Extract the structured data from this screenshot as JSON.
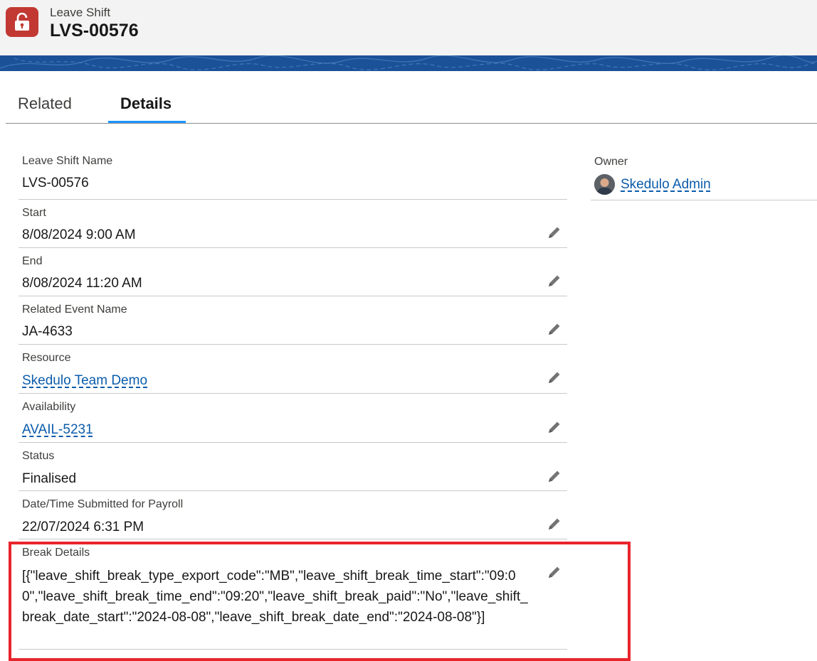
{
  "header": {
    "object_label": "Leave Shift",
    "record_title": "LVS-00576",
    "icon": "lock-icon",
    "icon_color": "#c23934",
    "banner_color": "#1b5297"
  },
  "tabs": [
    {
      "label": "Related",
      "active": false
    },
    {
      "label": "Details",
      "active": true
    }
  ],
  "fields": {
    "name": {
      "label": "Leave Shift Name",
      "value": "LVS-00576"
    },
    "start": {
      "label": "Start",
      "value": "8/08/2024 9:00 AM"
    },
    "end": {
      "label": "End",
      "value": "8/08/2024 11:20 AM"
    },
    "related_event": {
      "label": "Related Event Name",
      "value": "JA-4633"
    },
    "resource": {
      "label": "Resource",
      "value": "Skedulo Team Demo"
    },
    "availability": {
      "label": "Availability",
      "value": "AVAIL-5231"
    },
    "status": {
      "label": "Status",
      "value": "Finalised"
    },
    "submitted": {
      "label": "Date/Time Submitted for Payroll",
      "value": "22/07/2024 6:31 PM"
    },
    "break_details": {
      "label": "Break Details",
      "value": "[{\"leave_shift_break_type_export_code\":\"MB\",\"leave_shift_break_time_start\":\"09:00\",\"leave_shift_break_time_end\":\"09:20\",\"leave_shift_break_paid\":\"No\",\"leave_shift_break_date_start\":\"2024-08-08\",\"leave_shift_break_date_end\":\"2024-08-08\"}]"
    }
  },
  "owner": {
    "label": "Owner",
    "value": "Skedulo Admin"
  },
  "colors": {
    "link": "#0b5cab",
    "active_tab": "#1b96ff",
    "highlight_box": "#e8242c"
  }
}
